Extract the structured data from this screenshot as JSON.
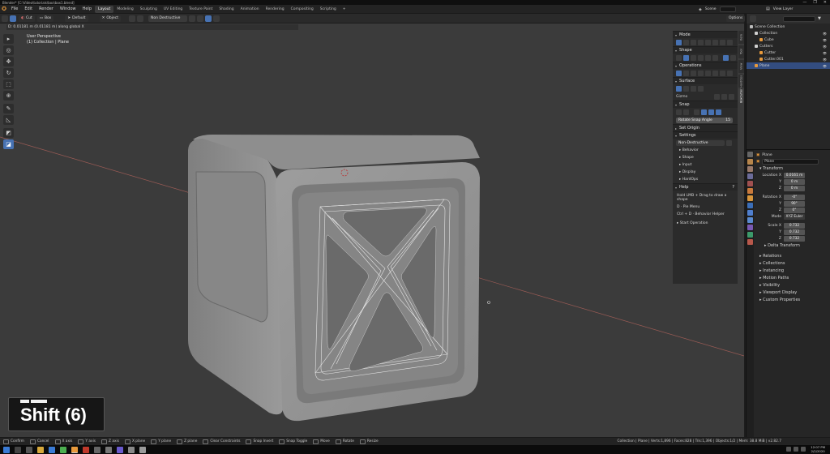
{
  "titlebar": {
    "text": "Blender* [C:\\Video\\tutorials\\box\\box1.blend]",
    "controls": [
      "—",
      "❐",
      "✕"
    ]
  },
  "menubar": {
    "menus": [
      "File",
      "Edit",
      "Render",
      "Window",
      "Help"
    ],
    "workspaces": [
      "Layout",
      "Modeling",
      "Sculpting",
      "UV Editing",
      "Texture Paint",
      "Shading",
      "Animation",
      "Rendering",
      "Compositing",
      "Scripting"
    ],
    "active_workspace": "Layout",
    "add_tab": "+",
    "scene_label": "Scene",
    "view_layer_label": "View Layer"
  },
  "header": {
    "pivot_label": "Cut",
    "box_label": "Box",
    "default_label": "Default",
    "object_label": "Object",
    "mode_label": "Non Destructive",
    "options_label": "Options"
  },
  "viewport": {
    "info": "D: 0.01181 m (0.01181 m) along global X",
    "view_name": "User Perspective",
    "collection": "(1) Collection | Plane"
  },
  "key_overlay": {
    "text": "Shift (6)"
  },
  "npanel": {
    "sections": {
      "mode": "Mode",
      "shape": "Shape",
      "operations": "Operations",
      "surface": "Surface",
      "snap": "Snap",
      "set_origin": "Set Origin",
      "settings": "Settings",
      "help": "Help"
    },
    "gizmo_label": "Gizmo",
    "rotate_snap_label": "Rotate Snap Angle",
    "rotate_snap_value": "15",
    "settings_mode": "Non-Destructive",
    "settings_sub": [
      "Behavior",
      "Shape",
      "Input",
      "Display",
      "HardOps"
    ],
    "help_lines": [
      "Hold LMB + Drag to draw a shape",
      "D · Pie Menu",
      "Ctrl + D · Behavior Helper"
    ],
    "start_operation": "Start Operation",
    "tabs": [
      "Item",
      "Tool",
      "View",
      "HardOps",
      "BoxCutter"
    ]
  },
  "outliner": {
    "title": "Scene Collection",
    "rows": [
      {
        "label": "Collection",
        "indent": 1,
        "color": "#d0d0d0"
      },
      {
        "label": "Cube",
        "indent": 2,
        "color": "#e89a3c"
      },
      {
        "label": "Cutters",
        "indent": 1,
        "color": "#d0d0d0"
      },
      {
        "label": "Cutter",
        "indent": 2,
        "color": "#e89a3c"
      },
      {
        "label": "Cutter.001",
        "indent": 2,
        "color": "#e89a3c"
      },
      {
        "label": "Plane",
        "indent": 1,
        "color": "#e89a3c",
        "selected": true
      }
    ]
  },
  "properties": {
    "object_name": "Plane",
    "data_name": "Plane",
    "transform_label": "Transform",
    "location": {
      "label": "Location X",
      "x": "0.0161 m",
      "y": "0 m",
      "z": "0 m"
    },
    "rotation": {
      "label": "Rotation X",
      "x": "-0°",
      "y": "90°",
      "z": "0°"
    },
    "mode": {
      "label": "Mode",
      "value": "XYZ Euler"
    },
    "scale": {
      "label": "Scale X",
      "x": "0.732",
      "y": "0.732",
      "z": "0.732"
    },
    "axis_y": "Y",
    "axis_z": "Z",
    "delta_transform": "Delta Transform",
    "sections": [
      "Relations",
      "Collections",
      "Instancing",
      "Motion Paths",
      "Visibility",
      "Viewport Display",
      "Custom Properties"
    ]
  },
  "statusbar": {
    "items": [
      "Confirm",
      "Cancel",
      "X axis",
      "Y axis",
      "Z axis",
      "X plane",
      "Y plane",
      "Z plane",
      "Clear Constraints",
      "Snap Invert",
      "Snap Toggle",
      "Move",
      "Rotate",
      "Resize"
    ],
    "stats": "Collection | Plane | Verts:1,896 | Faces:828 | Tris:1,396 | Objects:1/2 | Mem: 38.8 MiB | v2.82.7"
  },
  "taskbar": {
    "time": "12:07 PM",
    "date": "2/2/2020"
  },
  "colors": {
    "accent": "#4772b3",
    "object_orange": "#e89a3c",
    "viewport_bg": "#3b3b3b"
  }
}
